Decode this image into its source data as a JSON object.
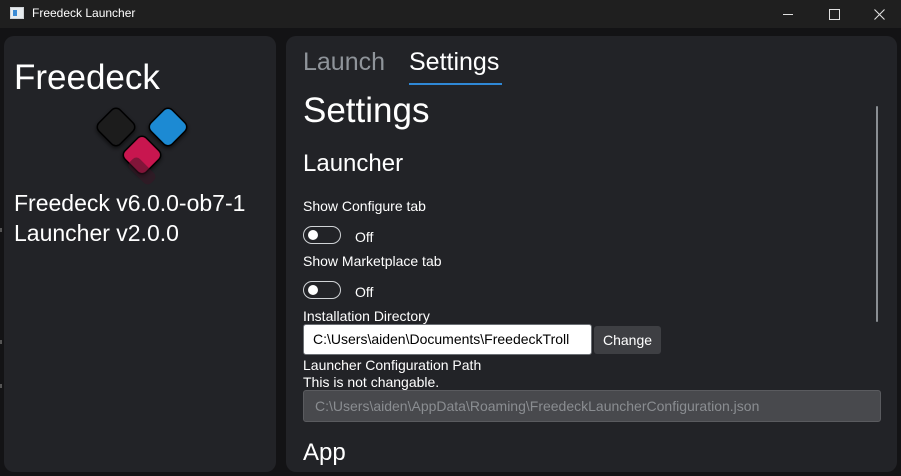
{
  "window": {
    "title": "Freedeck Launcher",
    "controls": [
      "minimize-icon",
      "maximize-icon",
      "close-icon"
    ]
  },
  "sidebar": {
    "brand": "Freedeck",
    "version": "Freedeck v6.0.0-ob7-1",
    "launcher_version": "Launcher v2.0.0",
    "logo_colors": {
      "dark": "#1b1c1f",
      "blue": "#1c8ad3",
      "magenta": "#c8154f"
    }
  },
  "tabs": [
    {
      "label": "Launch",
      "active": false
    },
    {
      "label": "Settings",
      "active": true
    }
  ],
  "accent": "#2f88d6",
  "settings": {
    "heading": "Settings",
    "launcher_heading": "Launcher",
    "show_configure": {
      "label": "Show Configure tab",
      "state": "Off",
      "enabled": false
    },
    "show_marketplace": {
      "label": "Show Marketplace tab",
      "state": "Off",
      "enabled": false
    },
    "install_dir": {
      "label": "Installation Directory",
      "value": "C:\\Users\\aiden\\Documents\\FreedeckTroll",
      "button": "Change"
    },
    "config_path": {
      "label": "Launcher Configuration Path",
      "note": "This is not changable.",
      "value": "C:\\Users\\aiden\\AppData\\Roaming\\FreedeckLauncherConfiguration.json"
    },
    "app_heading": "App"
  }
}
